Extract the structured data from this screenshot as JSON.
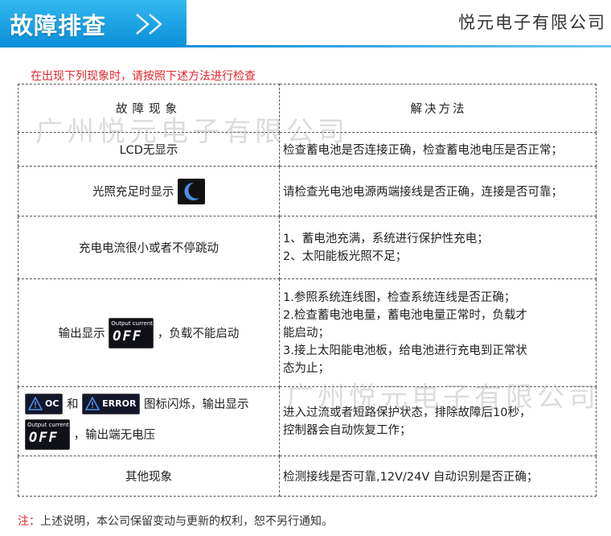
{
  "header": {
    "banner_title": "故障排查",
    "company": "悦元电子有限公司",
    "accent": "#0a8fd8"
  },
  "intro": "在出现下列现象时，请按照下述方法进行检查",
  "table": {
    "col_phenomenon": "故障现象",
    "col_solution": "解决方法",
    "rows": [
      {
        "phenomenon": "LCD无显示",
        "solution": [
          "检查蓄电池是否连接正确，检查蓄电池电压是否正常；"
        ]
      },
      {
        "phenomenon": "光照充足时显示",
        "icon": "moon-icon",
        "solution": [
          "请检查光电池电源两端接线是否正确，连接是否可靠；"
        ]
      },
      {
        "phenomenon": "充电电流很小或者不停跳动",
        "solution": [
          "1、蓄电池充满，系统进行保护性充电；",
          "2、太阳能板光照不足；"
        ]
      },
      {
        "phenomenon_pre": "输出显示",
        "phenomenon_post": "，负载不能启动",
        "icon": "output-off-lcd-icon",
        "lcd_top": "Output current",
        "lcd_text": "OFF",
        "solution": [
          "1.参照系统连线图，检查系统连线是否正确；",
          "2.检查蓄电池电量，蓄电池电量正常时，负载才",
          "能启动；",
          "3.接上太阳能电池板，给电池进行充电到正常状",
          "态为止；"
        ]
      },
      {
        "badge_oc": "OC",
        "and": "和",
        "badge_error": "ERROR",
        "phenomenon_line1": "图标闪烁，输出显示",
        "phenomenon_line2": "，输出端无电压",
        "lcd_top": "Output current",
        "lcd_text": "OFF",
        "solution": [
          "进入过流或者短路保护状态，排除故障后10秒，",
          "控制器会自动恢复工作；"
        ]
      },
      {
        "phenomenon": "其他现象",
        "solution": [
          "检测接线是否可靠,12V/24V 自动识别是否正确；"
        ]
      }
    ]
  },
  "note": {
    "mark": "注：",
    "text": "上述说明，本公司保留变动与更新的权利，恕不另行通知。"
  },
  "watermark": "广州悦元电子有限公司"
}
